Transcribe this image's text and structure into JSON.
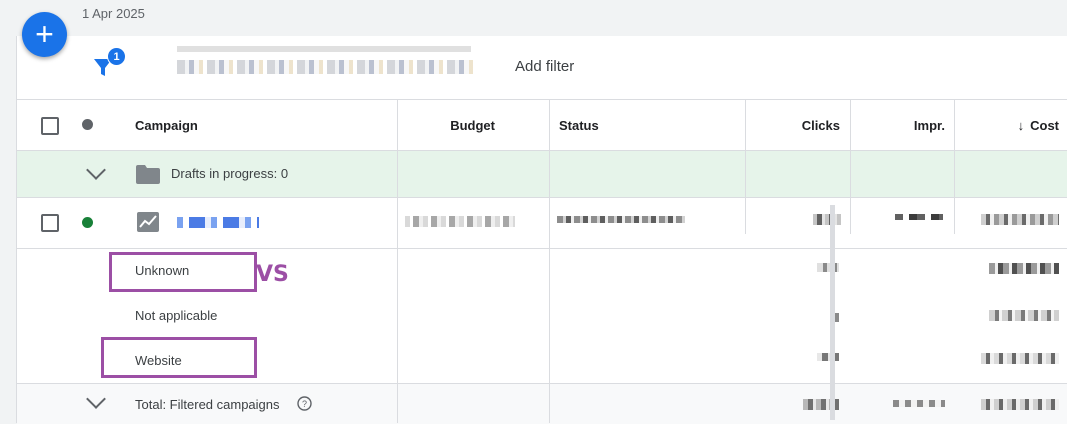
{
  "date_range": {
    "label": "1 Apr 2025"
  },
  "fab": {
    "icon": "plus-icon",
    "symbol": "+"
  },
  "filter_bar": {
    "filter_count": "1",
    "add_filter_label": "Add filter"
  },
  "table": {
    "columns": {
      "campaign": "Campaign",
      "budget": "Budget",
      "status": "Status",
      "clicks": "Clicks",
      "impressions": "Impr.",
      "cost": "Cost"
    },
    "sort": {
      "column": "cost",
      "direction": "descending",
      "icon": "arrow-down-icon",
      "symbol": "↓"
    },
    "drafts_row": {
      "label": "Drafts in progress: 0"
    },
    "campaign_row": {
      "status_color": "#188038"
    },
    "segment_rows": [
      {
        "label": "Unknown"
      },
      {
        "label": "Not applicable"
      },
      {
        "label": "Website"
      }
    ],
    "total_row": {
      "label": "Total: Filtered campaigns",
      "help_icon": "help-circle-icon"
    }
  },
  "annotation": {
    "text": "VS",
    "color": "#9c4fa5"
  },
  "colors": {
    "accent": "#1a73e8",
    "drafts_bg": "#e6f4ea",
    "active_dot": "#188038"
  }
}
